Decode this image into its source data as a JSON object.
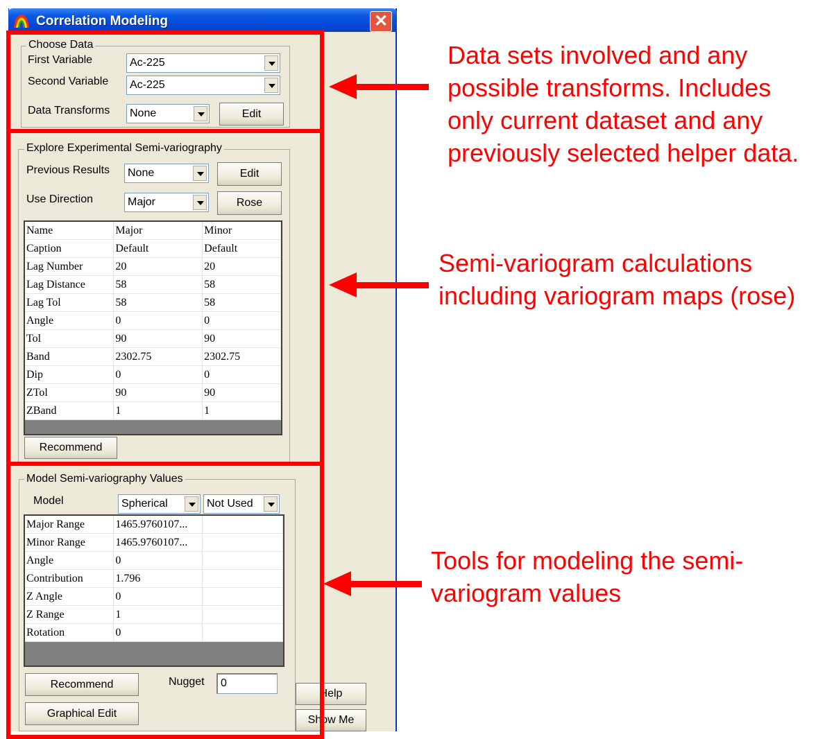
{
  "window": {
    "title": "Correlation Modeling",
    "close_symbol": "✕"
  },
  "choose_data": {
    "legend": "Choose Data",
    "first_variable_label": "First Variable",
    "first_variable_value": "Ac-225",
    "second_variable_label": "Second Variable",
    "second_variable_value": "Ac-225",
    "transforms_label": "Data Transforms",
    "transforms_value": "None",
    "edit_label": "Edit"
  },
  "explore": {
    "legend": "Explore Experimental Semi-variography",
    "previous_results_label": "Previous Results",
    "previous_results_value": "None",
    "edit_label": "Edit",
    "use_direction_label": "Use Direction",
    "use_direction_value": "Major",
    "rose_label": "Rose",
    "recommend_label": "Recommend",
    "rows": [
      [
        "Name",
        "Major",
        "Minor"
      ],
      [
        "Caption",
        "Default",
        "Default"
      ],
      [
        "Lag Number",
        "20",
        "20"
      ],
      [
        "Lag Distance",
        "58",
        "58"
      ],
      [
        "Lag Tol",
        "58",
        "58"
      ],
      [
        "Angle",
        "0",
        "0"
      ],
      [
        "Tol",
        "90",
        "90"
      ],
      [
        "Band",
        "2302.75",
        "2302.75"
      ],
      [
        "Dip",
        "0",
        "0"
      ],
      [
        "ZTol",
        "90",
        "90"
      ],
      [
        "ZBand",
        "1",
        "1"
      ]
    ]
  },
  "model": {
    "legend": "Model Semi-variography Values",
    "model_label": "Model",
    "model_value": "Spherical",
    "second_value": "Not Used",
    "rows": [
      [
        "Major Range",
        "1465.9760107...",
        ""
      ],
      [
        "Minor Range",
        "1465.9760107...",
        ""
      ],
      [
        "Angle",
        "0",
        ""
      ],
      [
        "Contribution",
        "1.796",
        ""
      ],
      [
        "Z Angle",
        "0",
        ""
      ],
      [
        "Z Range",
        "1",
        ""
      ],
      [
        "Rotation",
        "0",
        ""
      ]
    ],
    "recommend_label": "Recommend",
    "graphical_edit_label": "Graphical Edit",
    "nugget_label": "Nugget",
    "nugget_value": "0"
  },
  "side_buttons": {
    "help_label": "Help",
    "show_me_label": "Show Me"
  },
  "annotations": {
    "top": [
      "Data sets involved and any",
      "possible transforms. Includes",
      "only current dataset and any",
      "previously selected helper data."
    ],
    "middle": [
      "Semi-variogram calculations",
      "including variogram maps (rose)"
    ],
    "bottom": [
      "Tools for modeling the semi-",
      "variogram values"
    ]
  },
  "colors": {
    "annotation_red": "#ff0000",
    "title_blue": "#0548d6",
    "window_bg": "#ece9d8"
  }
}
